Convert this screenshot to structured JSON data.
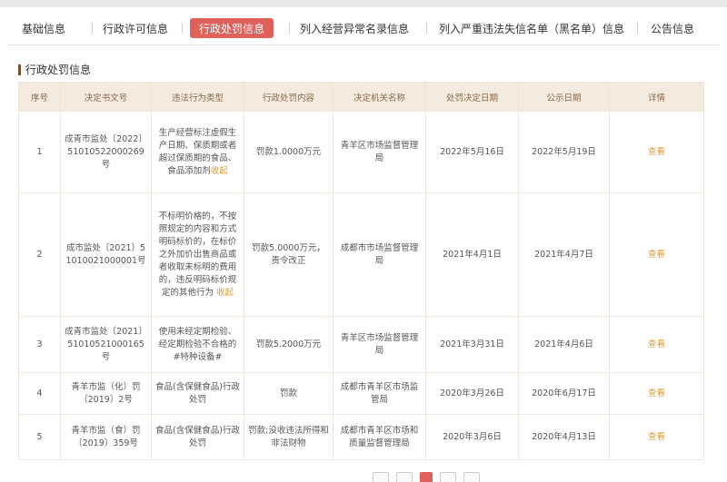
{
  "tabs": [
    {
      "label": "基础信息"
    },
    {
      "label": "行政许可信息"
    },
    {
      "label": "行政处罚信息"
    },
    {
      "label": "列入经营异常名录信息"
    },
    {
      "label": "列入严重违法失信名单（黑名单）信息"
    },
    {
      "label": "公告信息"
    }
  ],
  "section_title": "行政处罚信息",
  "table": {
    "headers": [
      "序号",
      "决定书文号",
      "违法行为类型",
      "行政处罚内容",
      "决定机关名称",
      "处罚决定日期",
      "公示日期",
      "详情"
    ],
    "collapse_label": "收起",
    "detail_label": "查看",
    "rows": [
      {
        "no": "1",
        "doc": "成青市监处〔2022〕51010522000269号",
        "violation": "生产经营标注虚假生产日期、保质期或者超过保质期的食品、食品添加剂",
        "has_collapse": true,
        "content": "罚款1.0000万元",
        "org": "青羊区市场监督管理局",
        "decision_date": "2022年5月16日",
        "publish_date": "2022年5月19日"
      },
      {
        "no": "2",
        "doc": "成市监处〔2021〕51010021000001号",
        "violation": "不标明价格的，不按照规定的内容和方式明码标价的，在标价之外加价出售商品或者收取未标明的费用的，违反明码标价规定的其他行为",
        "has_collapse": true,
        "content": "罚款5.0000万元，责令改正",
        "org": "成都市市场监督管理局",
        "decision_date": "2021年4月1日",
        "publish_date": "2021年4月7日"
      },
      {
        "no": "3",
        "doc": "成青市监处〔2021〕51010521000165号",
        "violation": "使用未经定期检验、经定期检验不合格的#特种设备#",
        "has_collapse": false,
        "content": "罚款5.2000万元",
        "org": "青羊区市场监督管理局",
        "decision_date": "2021年3月31日",
        "publish_date": "2021年4月6日"
      },
      {
        "no": "4",
        "doc": "青羊市监（化）罚〔2019〕2号",
        "violation": "食品(含保健食品)行政处罚",
        "has_collapse": false,
        "content": "罚款",
        "org": "成都市青羊区市场监管局",
        "decision_date": "2020年3月26日",
        "publish_date": "2020年6月17日"
      },
      {
        "no": "5",
        "doc": "青羊市监（食）罚〔2019〕359号",
        "violation": "食品(含保健食品)行政处罚",
        "has_collapse": false,
        "content": "罚款;没收违法所得和非法财物",
        "org": "成都市青羊区市场和质量监督管理局",
        "decision_date": "2020年3月6日",
        "publish_date": "2020年4月13日"
      }
    ]
  },
  "colors": {
    "accent": "#e0605a",
    "header_bg": "#f3ebe0",
    "link": "#e09a2c"
  }
}
